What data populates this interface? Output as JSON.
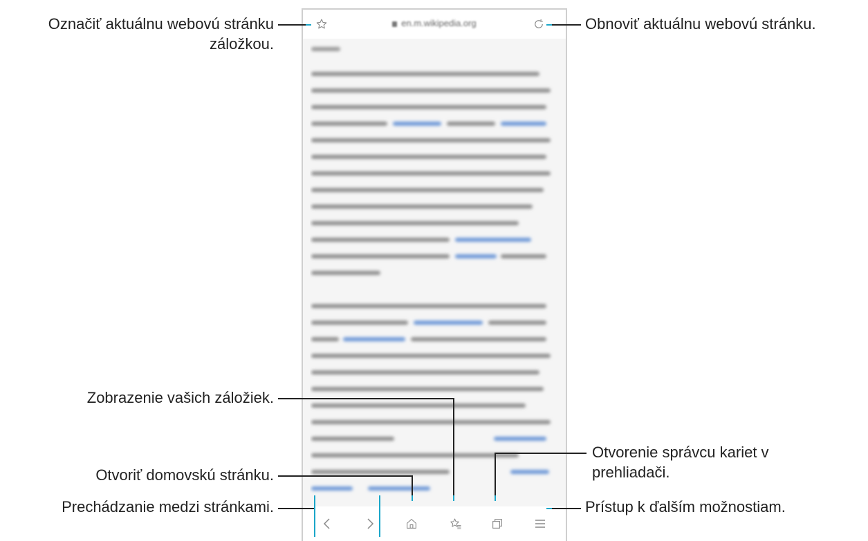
{
  "url_bar": {
    "url": "en.m.wikipedia.org"
  },
  "annotations": {
    "bookmark": "Označiť aktuálnu webovú stránku záložkou.",
    "bookmark_l1": "Označiť aktuálnu webovú stránku",
    "bookmark_l2": "záložkou.",
    "refresh": "Obnoviť aktuálnu webovú stránku.",
    "view_bookmarks": "Zobrazenie vašich záložiek.",
    "home": "Otvoriť domovskú stránku.",
    "navigate": "Prechádzanie medzi stránkami.",
    "tabs_l1": "Otvorenie správcu kariet v",
    "tabs_l2": "prehliadači.",
    "more": "Prístup k ďalším možnostiam."
  },
  "icons": {
    "bookmark_star": "star-outline-icon",
    "refresh": "refresh-icon",
    "back": "chevron-left-icon",
    "forward": "chevron-right-icon",
    "home": "home-icon",
    "bookmarks": "star-list-icon",
    "tabs": "tabs-icon",
    "menu": "hamburger-menu-icon"
  },
  "colors": {
    "accent": "#1aa6c9",
    "callout_line": "#222222"
  }
}
